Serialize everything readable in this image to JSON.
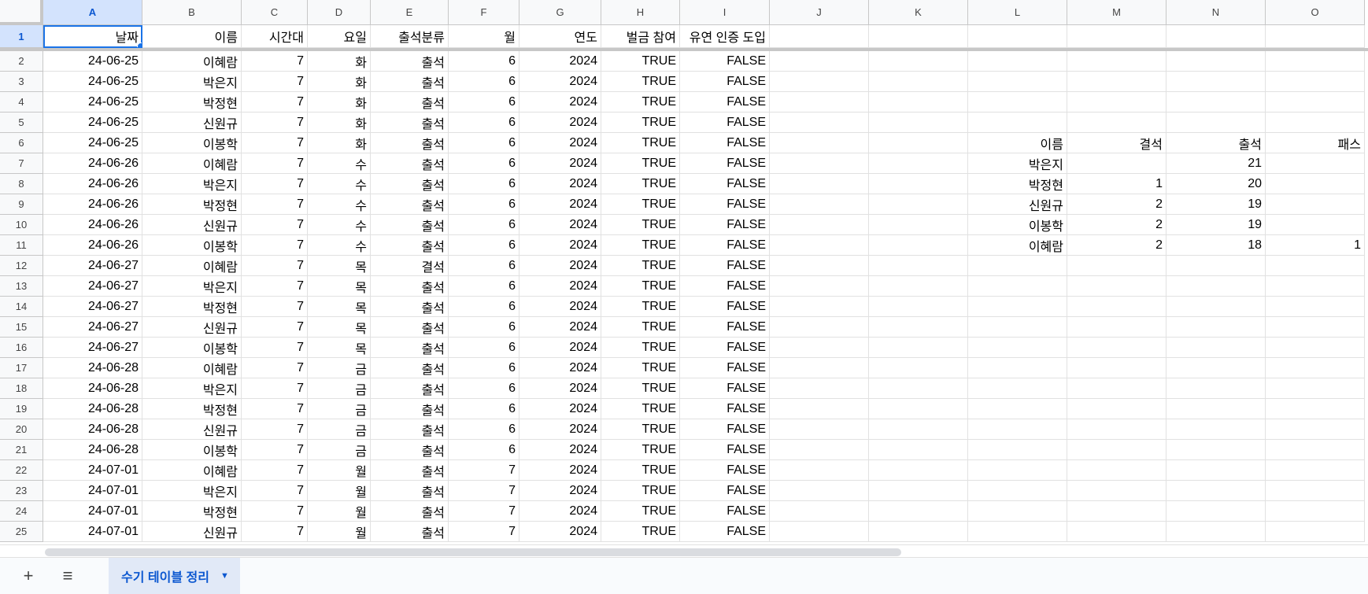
{
  "columns": [
    "A",
    "B",
    "C",
    "D",
    "E",
    "F",
    "G",
    "H",
    "I",
    "J",
    "K",
    "L",
    "M",
    "N",
    "O"
  ],
  "selected_column": "A",
  "selected_row": "1",
  "header_row": {
    "row_number": "1",
    "cells": [
      "날짜",
      "이름",
      "시간대",
      "요일",
      "출석분류",
      "월",
      "연도",
      "벌금 참여",
      "유연 인증 도입",
      "",
      "",
      "",
      "",
      "",
      ""
    ]
  },
  "rows": [
    {
      "n": "2",
      "cells": [
        "24-06-25",
        "이혜람",
        "7",
        "화",
        "출석",
        "6",
        "2024",
        "TRUE",
        "FALSE",
        "",
        "",
        "",
        "",
        "",
        ""
      ]
    },
    {
      "n": "3",
      "cells": [
        "24-06-25",
        "박은지",
        "7",
        "화",
        "출석",
        "6",
        "2024",
        "TRUE",
        "FALSE",
        "",
        "",
        "",
        "",
        "",
        ""
      ]
    },
    {
      "n": "4",
      "cells": [
        "24-06-25",
        "박정현",
        "7",
        "화",
        "출석",
        "6",
        "2024",
        "TRUE",
        "FALSE",
        "",
        "",
        "",
        "",
        "",
        ""
      ]
    },
    {
      "n": "5",
      "cells": [
        "24-06-25",
        "신원규",
        "7",
        "화",
        "출석",
        "6",
        "2024",
        "TRUE",
        "FALSE",
        "",
        "",
        "",
        "",
        "",
        ""
      ]
    },
    {
      "n": "6",
      "cells": [
        "24-06-25",
        "이봉학",
        "7",
        "화",
        "출석",
        "6",
        "2024",
        "TRUE",
        "FALSE",
        "",
        "",
        "이름",
        "결석",
        "출석",
        "패스"
      ]
    },
    {
      "n": "7",
      "cells": [
        "24-06-26",
        "이혜람",
        "7",
        "수",
        "출석",
        "6",
        "2024",
        "TRUE",
        "FALSE",
        "",
        "",
        "박은지",
        "",
        "21",
        ""
      ]
    },
    {
      "n": "8",
      "cells": [
        "24-06-26",
        "박은지",
        "7",
        "수",
        "출석",
        "6",
        "2024",
        "TRUE",
        "FALSE",
        "",
        "",
        "박정현",
        "1",
        "20",
        ""
      ]
    },
    {
      "n": "9",
      "cells": [
        "24-06-26",
        "박정현",
        "7",
        "수",
        "출석",
        "6",
        "2024",
        "TRUE",
        "FALSE",
        "",
        "",
        "신원규",
        "2",
        "19",
        ""
      ]
    },
    {
      "n": "10",
      "cells": [
        "24-06-26",
        "신원규",
        "7",
        "수",
        "출석",
        "6",
        "2024",
        "TRUE",
        "FALSE",
        "",
        "",
        "이봉학",
        "2",
        "19",
        ""
      ]
    },
    {
      "n": "11",
      "cells": [
        "24-06-26",
        "이봉학",
        "7",
        "수",
        "출석",
        "6",
        "2024",
        "TRUE",
        "FALSE",
        "",
        "",
        "이혜람",
        "2",
        "18",
        "1"
      ]
    },
    {
      "n": "12",
      "cells": [
        "24-06-27",
        "이혜람",
        "7",
        "목",
        "결석",
        "6",
        "2024",
        "TRUE",
        "FALSE",
        "",
        "",
        "",
        "",
        "",
        ""
      ]
    },
    {
      "n": "13",
      "cells": [
        "24-06-27",
        "박은지",
        "7",
        "목",
        "출석",
        "6",
        "2024",
        "TRUE",
        "FALSE",
        "",
        "",
        "",
        "",
        "",
        ""
      ]
    },
    {
      "n": "14",
      "cells": [
        "24-06-27",
        "박정현",
        "7",
        "목",
        "출석",
        "6",
        "2024",
        "TRUE",
        "FALSE",
        "",
        "",
        "",
        "",
        "",
        ""
      ]
    },
    {
      "n": "15",
      "cells": [
        "24-06-27",
        "신원규",
        "7",
        "목",
        "출석",
        "6",
        "2024",
        "TRUE",
        "FALSE",
        "",
        "",
        "",
        "",
        "",
        ""
      ]
    },
    {
      "n": "16",
      "cells": [
        "24-06-27",
        "이봉학",
        "7",
        "목",
        "출석",
        "6",
        "2024",
        "TRUE",
        "FALSE",
        "",
        "",
        "",
        "",
        "",
        ""
      ]
    },
    {
      "n": "17",
      "cells": [
        "24-06-28",
        "이혜람",
        "7",
        "금",
        "출석",
        "6",
        "2024",
        "TRUE",
        "FALSE",
        "",
        "",
        "",
        "",
        "",
        ""
      ]
    },
    {
      "n": "18",
      "cells": [
        "24-06-28",
        "박은지",
        "7",
        "금",
        "출석",
        "6",
        "2024",
        "TRUE",
        "FALSE",
        "",
        "",
        "",
        "",
        "",
        ""
      ]
    },
    {
      "n": "19",
      "cells": [
        "24-06-28",
        "박정현",
        "7",
        "금",
        "출석",
        "6",
        "2024",
        "TRUE",
        "FALSE",
        "",
        "",
        "",
        "",
        "",
        ""
      ]
    },
    {
      "n": "20",
      "cells": [
        "24-06-28",
        "신원규",
        "7",
        "금",
        "출석",
        "6",
        "2024",
        "TRUE",
        "FALSE",
        "",
        "",
        "",
        "",
        "",
        ""
      ]
    },
    {
      "n": "21",
      "cells": [
        "24-06-28",
        "이봉학",
        "7",
        "금",
        "출석",
        "6",
        "2024",
        "TRUE",
        "FALSE",
        "",
        "",
        "",
        "",
        "",
        ""
      ]
    },
    {
      "n": "22",
      "cells": [
        "24-07-01",
        "이혜람",
        "7",
        "월",
        "출석",
        "7",
        "2024",
        "TRUE",
        "FALSE",
        "",
        "",
        "",
        "",
        "",
        ""
      ]
    },
    {
      "n": "23",
      "cells": [
        "24-07-01",
        "박은지",
        "7",
        "월",
        "출석",
        "7",
        "2024",
        "TRUE",
        "FALSE",
        "",
        "",
        "",
        "",
        "",
        ""
      ]
    },
    {
      "n": "24",
      "cells": [
        "24-07-01",
        "박정현",
        "7",
        "월",
        "출석",
        "7",
        "2024",
        "TRUE",
        "FALSE",
        "",
        "",
        "",
        "",
        "",
        ""
      ]
    },
    {
      "n": "25",
      "cells": [
        "24-07-01",
        "신원규",
        "7",
        "월",
        "출석",
        "7",
        "2024",
        "TRUE",
        "FALSE",
        "",
        "",
        "",
        "",
        "",
        ""
      ]
    }
  ],
  "tabbar": {
    "add_icon": "plus-icon",
    "menu_icon": "menu-icon",
    "sheet_tab_label": "수기 테이블 정리",
    "caret_icon": "caret-down-icon"
  },
  "colors": {
    "selection": "#d3e3fd",
    "accent": "#1a73e8",
    "tab_active": "#e1e9f7"
  }
}
